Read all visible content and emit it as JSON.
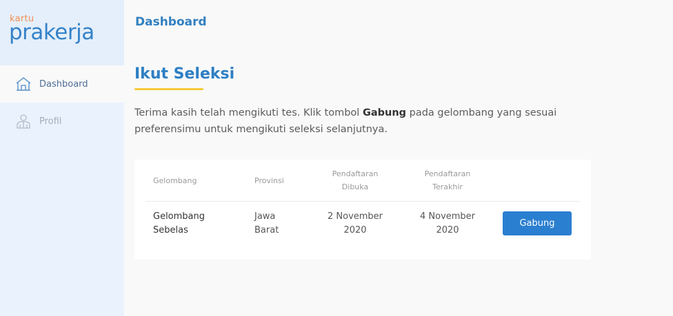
{
  "brand": {
    "small": "kartu",
    "big": "prakerja"
  },
  "sidebar": {
    "items": [
      {
        "label": "Dashboard",
        "icon": "home-icon",
        "active": true
      },
      {
        "label": "Profil",
        "icon": "user-icon",
        "active": false
      }
    ]
  },
  "header": {
    "title": "Dashboard"
  },
  "main": {
    "title": "Ikut Seleksi",
    "desc_before": "Terima kasih telah mengikuti tes. Klik tombol ",
    "desc_bold": "Gabung",
    "desc_after": " pada gelombang yang sesuai preferensimu untuk mengikuti seleksi selanjutnya."
  },
  "table": {
    "headers": [
      "Gelombang",
      "Provinsi",
      "Pendaftaran Dibuka",
      "Pendaftaran Terakhir"
    ],
    "rows": [
      {
        "gelombang": "Gelombang Sebelas",
        "provinsi": "Jawa Barat",
        "dibuka": "2 November 2020",
        "terakhir": "4 November 2020",
        "action": "Gabung"
      }
    ]
  },
  "colors": {
    "accent": "#2b7fd0",
    "underline": "#f5c93a",
    "brand_orange": "#f18f55",
    "sidebar_bg": "#e9f2fd"
  }
}
